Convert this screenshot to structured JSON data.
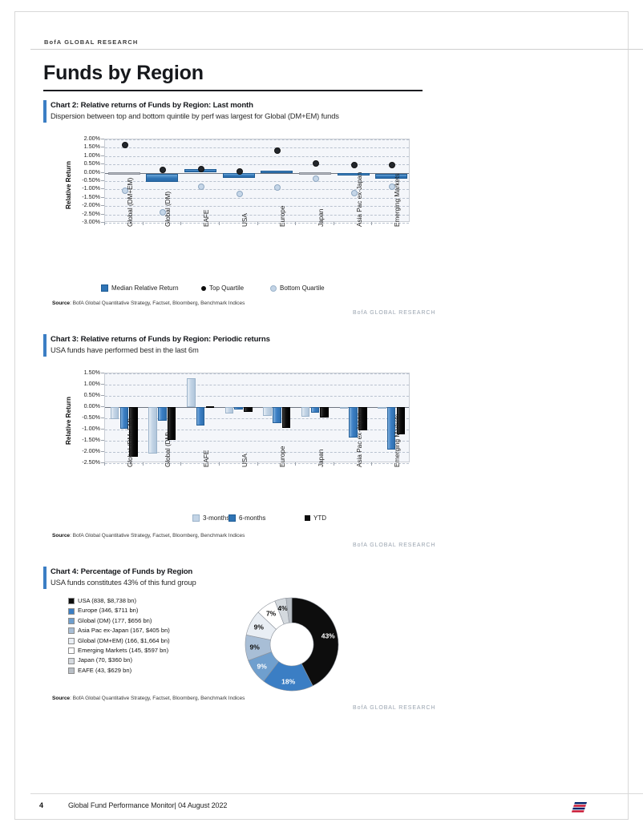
{
  "header": {
    "brand": "BofA GLOBAL RESEARCH",
    "page_title": "Funds by Region"
  },
  "footer": {
    "page_number": "4",
    "text": "Global Fund Performance Monitor| 04 August 2022",
    "logo": "bofa-flag-logo"
  },
  "source_label": "Source",
  "source_text": ": BofA Global Quantitative Strategy, Factset, Bloomberg, Benchmark Indices",
  "bofa_note": "BofA GLOBAL RESEARCH",
  "colors": {
    "accent_blue": "#3b7ec4",
    "bar_6m_blue": "#2f74b5",
    "bar_3m_lightblue": "#c3d4e6",
    "bar_ytd_black": "#0d0d0d",
    "plot_bg": "#f4f6fa",
    "flag_red": "#c8102e",
    "flag_blue": "#012169"
  },
  "chart2": {
    "title": "Chart 2: Relative returns of Funds by Region: Last month",
    "subtitle": "Dispersion between top and bottom quintile by perf was largest for Global (DM+EM) funds",
    "legend": [
      {
        "label": "Median Relative Return",
        "marker": "square-blue"
      },
      {
        "label": "Top Quartile",
        "marker": "dot-black"
      },
      {
        "label": "Bottom Quartile",
        "marker": "dot-lightblue"
      }
    ]
  },
  "chart3": {
    "title": "Chart 3: Relative returns of Funds by Region: Periodic returns",
    "subtitle": "USA funds have performed best in the last 6m",
    "legend": [
      {
        "label": "3-months",
        "marker": "square-lightblue"
      },
      {
        "label": "6-months",
        "marker": "square-blue"
      },
      {
        "label": "YTD",
        "marker": "square-black"
      }
    ]
  },
  "chart4": {
    "title": "Chart 4: Percentage of Funds by Region",
    "subtitle": "USA funds constitutes 43% of this fund group"
  },
  "chart_data": [
    {
      "type": "bar",
      "id": "chart2",
      "title": "Chart 2: Relative returns of Funds by Region: Last month",
      "subtitle": "Dispersion between top and bottom quintile by perf was largest for Global (DM+EM) funds",
      "ylabel": "Relative Return",
      "xlabel": "",
      "ylim": [
        -3.0,
        2.0
      ],
      "ytick_labels": [
        "2.00%",
        "1.50%",
        "1.00%",
        "0.50%",
        "0.00%",
        "-0.50%",
        "-1.00%",
        "-1.50%",
        "-2.00%",
        "-2.50%",
        "-3.00%"
      ],
      "grid": true,
      "legend_position": "bottom",
      "categories": [
        "Global (DM+EM)",
        "Global (DM)",
        "EAFE",
        "USA",
        "Europe",
        "Japan",
        "Asia Pac ex-Japan",
        "Emerging Markets"
      ],
      "series": [
        {
          "name": "Median Relative Return (box top)",
          "values": [
            0.03,
            -0.08,
            0.2,
            -0.02,
            0.14,
            0.02,
            0.0,
            -0.08
          ]
        },
        {
          "name": "Median Relative Return (box bottom)",
          "values": [
            -0.02,
            -0.55,
            0.02,
            -0.3,
            0.01,
            -0.06,
            -0.12,
            -0.36
          ]
        },
        {
          "name": "Top Quartile",
          "values": [
            1.7,
            0.22,
            0.25,
            0.12,
            1.38,
            0.61,
            0.5,
            0.53
          ]
        },
        {
          "name": "Bottom Quartile",
          "values": [
            -1.02,
            -2.32,
            -0.8,
            -1.2,
            -0.82,
            -0.32,
            -1.15,
            -0.8
          ]
        }
      ]
    },
    {
      "type": "bar",
      "id": "chart3",
      "title": "Chart 3: Relative returns of Funds by Region: Periodic returns",
      "subtitle": "USA funds have performed best in the last 6m",
      "ylabel": "Relative Return",
      "xlabel": "",
      "ylim": [
        -2.5,
        1.5
      ],
      "ytick_labels": [
        "1.50%",
        "1.00%",
        "0.50%",
        "0.00%",
        "-0.50%",
        "-1.00%",
        "-1.50%",
        "-2.00%",
        "-2.50%"
      ],
      "grid": true,
      "legend_position": "bottom",
      "categories": [
        "Global (DM+EM)",
        "Global (DM)",
        "EAFE",
        "USA",
        "Europe",
        "Japan",
        "Asia Pac ex-Japan",
        "Emerging Markets"
      ],
      "series": [
        {
          "name": "3-months",
          "values": [
            -0.52,
            -2.08,
            1.28,
            -0.28,
            -0.38,
            -0.42,
            -0.05,
            -0.03
          ]
        },
        {
          "name": "6-months",
          "values": [
            -0.97,
            -0.62,
            -0.82,
            -0.12,
            -0.72,
            -0.25,
            -1.36,
            -1.9
          ]
        },
        {
          "name": "YTD",
          "values": [
            -2.22,
            -1.45,
            0.02,
            -0.22,
            -0.92,
            -0.48,
            -1.05,
            -1.22
          ]
        }
      ]
    },
    {
      "type": "pie",
      "id": "chart4",
      "title": "Chart 4: Percentage of Funds by Region",
      "subtitle": "USA funds constitutes 43% of this fund group",
      "donut": true,
      "legend_position": "left",
      "labels": [
        "USA (838, $8,738 bn)",
        "Europe (346, $711 bn)",
        "Global (DM) (177, $656 bn)",
        "Asia Pac ex-Japan (167, $405 bn)",
        "Global (DM+EM) (166, $1,664 bn)",
        "Emerging Markets (145, $597 bn)",
        "Japan (70, $360 bn)",
        "EAFE (43, $629 bn)"
      ],
      "values": [
        43,
        18,
        9,
        9,
        9,
        7,
        4,
        2
      ],
      "value_labels": [
        "43%",
        "18%",
        "9%",
        "9%",
        "9%",
        "7%",
        "4%",
        ""
      ],
      "slice_colors": [
        "#0d0d0d",
        "#3b7ec4",
        "#6f9fce",
        "#a8bed6",
        "#e9eef4",
        "#ffffff",
        "#d4d9de",
        "#b9bfc6"
      ]
    }
  ]
}
